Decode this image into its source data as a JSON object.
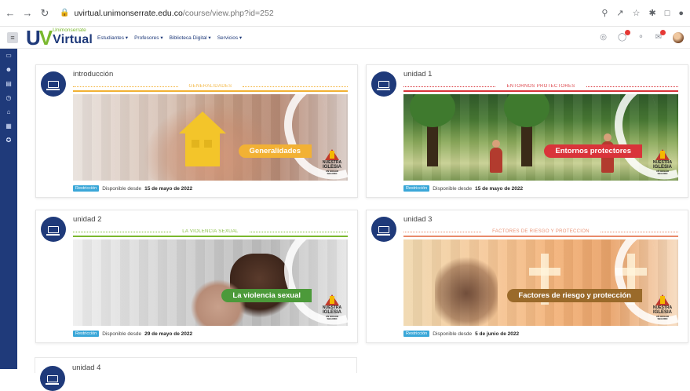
{
  "browser": {
    "url_domain": "uvirtual.unimonserrate.edu.co",
    "url_path": "/course/view.php?id=252",
    "icons": [
      "back-icon",
      "forward-icon",
      "reload-icon",
      "lock-icon",
      "zoom-icon",
      "share-icon",
      "star-icon",
      "extensions-icon",
      "split-view-icon",
      "profile-icon"
    ]
  },
  "site": {
    "logo_uv": "UV",
    "logo_small": "Unimonserrate",
    "logo_virtual": "Virtual",
    "menu": [
      "Estudiantes ▾",
      "Profesores ▾",
      "Biblioteca Digital ▾",
      "Servicios ▾"
    ],
    "brand_blue": "#1f3a7a",
    "brand_green": "#7ab82e"
  },
  "sidebar": {
    "icons": [
      "folder-icon",
      "participants-icon",
      "grades-icon",
      "dashboard-icon",
      "home-icon",
      "calendar-icon",
      "badge-icon"
    ]
  },
  "cards": [
    {
      "title": "introducción",
      "section_label": "GENERALIDADES",
      "ribbon": "Generalidades",
      "ribbon_color": "#f2b134",
      "accent": "#f2b134",
      "restriction_tag": "Restricción",
      "available_text": "Disponible desde",
      "available_date": "15 de mayo de 2022"
    },
    {
      "title": "unidad 1",
      "section_label": "ENTORNOS PROTECTORES",
      "ribbon": "Entornos protectores",
      "ribbon_color": "#d9343a",
      "accent": "#d9343a",
      "restriction_tag": "Restricción",
      "available_text": "Disponible desde",
      "available_date": "15 de mayo de 2022"
    },
    {
      "title": "unidad 2",
      "section_label": "LA VIOLENCIA SEXUAL",
      "ribbon": "La violencia sexual",
      "ribbon_color": "#4c9a3a",
      "accent": "#7ab82e",
      "restriction_tag": "Restricción",
      "available_text": "Disponible desde",
      "available_date": "29 de mayo de 2022"
    },
    {
      "title": "unidad 3",
      "section_label": "FACTORES DE RIESGO Y PROTECCIÓN",
      "ribbon": "Factores de riesgo y protección",
      "ribbon_color": "#9a6a2a",
      "accent": "#e98a6a",
      "restriction_tag": "Restricción",
      "available_text": "Disponible desde",
      "available_date": "5 de junio de 2022"
    }
  ],
  "church_logo": {
    "line1": "NUESTRA",
    "line2": "IGLESIA",
    "line3": "UN HOGAR SEGURO"
  },
  "partial_card": {
    "title": "unidad 4"
  }
}
